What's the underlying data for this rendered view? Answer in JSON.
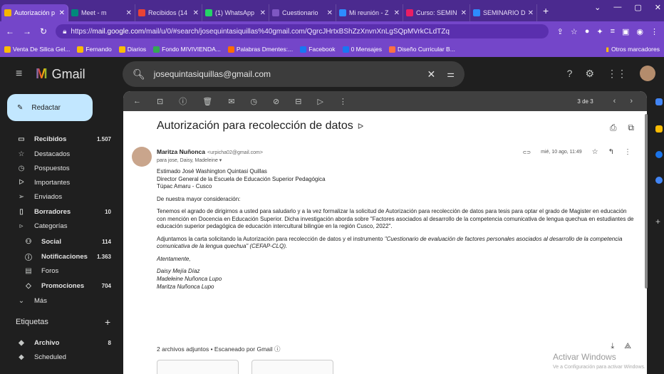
{
  "browser": {
    "tabs": [
      {
        "label": "Autorización p",
        "color": "#f4b400",
        "active": true
      },
      {
        "label": "Meet - m",
        "color": "#00897b",
        "active": false
      },
      {
        "label": "Recibidos (14",
        "color": "#ea4335",
        "active": false
      },
      {
        "label": "(1) WhatsApp",
        "color": "#25d366",
        "active": false
      },
      {
        "label": "Cuestionario",
        "color": "#7e57c2",
        "active": false
      },
      {
        "label": "Mi reunión - Z",
        "color": "#2d8cff",
        "active": false
      },
      {
        "label": "Curso: SEMIN",
        "color": "#e91e63",
        "active": false
      },
      {
        "label": "SEMINARIO D",
        "color": "#2d8cff",
        "active": false
      }
    ],
    "new_tab": "+",
    "url_prefix": "https://",
    "url_domain": "mail.google.com",
    "url_path": "/mail/u/0/#search/josequintasiquillas%40gmail.com/QgrcJHrtxBShZzXnvnXnLgSQpMVrkCLdTZq",
    "bookmarks": [
      {
        "label": "Venta De Silica Gel...",
        "color": "#fbbc04"
      },
      {
        "label": "Fernando",
        "color": "#fbbc04"
      },
      {
        "label": "Diarios",
        "color": "#fbbc04"
      },
      {
        "label": "Fondo MIVIVIENDA...",
        "color": "#34a853"
      },
      {
        "label": "Palabras Dmentes:...",
        "color": "#ff6d00"
      },
      {
        "label": "Facebook",
        "color": "#1877f2"
      },
      {
        "label": "0 Mensajes",
        "color": "#1877f2"
      },
      {
        "label": "Diseño Curricular B...",
        "color": "#ff7043"
      }
    ],
    "other_bookmarks": "Otros marcadores"
  },
  "gmail": {
    "product": "Gmail",
    "search_query": "josequintasiquillas@gmail.com",
    "compose": "Redactar",
    "nav": [
      {
        "label": "Recibidos",
        "count": "1.507",
        "bold": true,
        "icon": "inbox-icon",
        "glyph": "▭"
      },
      {
        "label": "Destacados",
        "count": "",
        "bold": false,
        "icon": "star-icon",
        "glyph": "☆"
      },
      {
        "label": "Pospuestos",
        "count": "",
        "bold": false,
        "icon": "clock-icon",
        "glyph": "◷"
      },
      {
        "label": "Importantes",
        "count": "",
        "bold": false,
        "icon": "important-icon",
        "glyph": "ᐅ"
      },
      {
        "label": "Enviados",
        "count": "",
        "bold": false,
        "icon": "send-icon",
        "glyph": "➢"
      },
      {
        "label": "Borradores",
        "count": "10",
        "bold": true,
        "icon": "draft-icon",
        "glyph": "▯"
      },
      {
        "label": "Categorías",
        "count": "",
        "bold": false,
        "icon": "label-icon",
        "glyph": "▹"
      },
      {
        "label": "Social",
        "count": "114",
        "bold": true,
        "icon": "people-icon",
        "glyph": "⚇",
        "sub": true
      },
      {
        "label": "Notificaciones",
        "count": "1.363",
        "bold": true,
        "icon": "info-icon",
        "glyph": "ⓘ",
        "sub": true
      },
      {
        "label": "Foros",
        "count": "",
        "bold": false,
        "icon": "forum-icon",
        "glyph": "▤",
        "sub": true
      },
      {
        "label": "Promociones",
        "count": "704",
        "bold": true,
        "icon": "tag-icon",
        "glyph": "◇",
        "sub": true
      },
      {
        "label": "Más",
        "count": "",
        "bold": false,
        "icon": "chevron-down-icon",
        "glyph": "⌄"
      }
    ],
    "labels_heading": "Etiquetas",
    "labels": [
      {
        "label": "Archivo",
        "count": "8",
        "bold": true
      },
      {
        "label": "Scheduled",
        "count": "",
        "bold": false
      }
    ],
    "pagination": "3 de 3",
    "message": {
      "subject": "Autorización para recolección de datos",
      "sender_name": "Maritza Nuñonca",
      "sender_email": "<urpicha02@gmail.com>",
      "to": "para jose, Daisy, Madeleine ▾",
      "date": "mié, 10 ago, 11:49",
      "paragraphs": [
        [
          "Estimado José Washington Quintasi Quillas",
          "Director General de la Escuela de Educación Superior Pedagógica",
          "Túpac Amaru - Cusco"
        ],
        [
          "De nuestra mayor consideración:"
        ],
        [
          "Tenemos el agrado de dirigirnos a usted para saludarlo y a la vez formalizar la solicitud de Autorización para recolección de datos para tesis para optar el grado de Magister en educación con mención en Docencia en Educación Superior. Dicha investigación aborda sobre \"Factores asociados al desarrollo de la competencia comunicativa de lengua quechua en estudiantes de educación superior pedagógica de educación intercultural bilingüe en la región Cusco, 2022\"."
        ]
      ],
      "attach_para_lead": "Adjuntamos la carta solicitando la Autorización para recolección de datos y el instrumento ",
      "attach_para_italic": "\"Cuestionario de evaluación de factores personales asociados al desarrollo de la competencia comunicativa de la lengua quechua\" (CEFAP-CLQ).",
      "closing": "Atentamente,",
      "signatures": [
        "Daisy Mejía Díaz",
        "Madeleine Nuñonca Lupo",
        "Maritza Nuñonca Lupo"
      ],
      "attachments_summary": "2 archivos adjuntos  •  Escaneado por Gmail ⓘ"
    }
  },
  "watermark": {
    "title": "Activar Windows",
    "subtitle": "Ve a Configuración para activar Windows."
  }
}
